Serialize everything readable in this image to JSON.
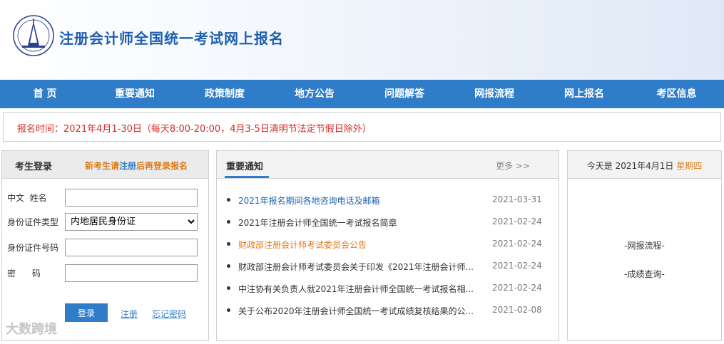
{
  "header": {
    "title": "注册会计师全国统一考试网上报名",
    "logo_icon": "cicpa-emblem-icon"
  },
  "nav": [
    {
      "label": "首 页"
    },
    {
      "label": "重要通知"
    },
    {
      "label": "政策制度"
    },
    {
      "label": "地方公告"
    },
    {
      "label": "问题解答"
    },
    {
      "label": "网报流程"
    },
    {
      "label": "网上报名"
    },
    {
      "label": "考区信息"
    }
  ],
  "notice": {
    "text": "报名时间：2021年4月1-30日（每天8:00-20:00，4月3-5日清明节法定节假日除外）"
  },
  "login": {
    "title": "考生登录",
    "hint_prefix": "新考生请",
    "hint_link": "注册",
    "hint_suffix": "后再登录报名",
    "name_label": "中文  姓名",
    "id_type_label": "身份证件类型",
    "id_type_value": "内地居民身份证",
    "id_number_label": "身份证件号码",
    "password_label": "密      码",
    "login_button": "登录",
    "register_link": "注册",
    "forgot_link": "忘记密码"
  },
  "news": {
    "title": "重要通知",
    "more": "更多 >>",
    "items": [
      {
        "title": "2021年报名期间各地咨询电话及邮箱",
        "date": "2021-03-31",
        "color": "#1d5fae"
      },
      {
        "title": "2021年注册会计师全国统一考试报名简章",
        "date": "2021-02-24",
        "color": "#333333"
      },
      {
        "title": "财政部注册会计师考试委员会公告",
        "date": "2021-02-24",
        "color": "#e07b1a"
      },
      {
        "title": "财政部注册会计师考试委员会关于印发《2021年注册会计师...",
        "date": "2021-02-24",
        "color": "#333333"
      },
      {
        "title": "中注协有关负责人就2021年注册会计师全国统一考试报名相...",
        "date": "2021-02-24",
        "color": "#333333"
      },
      {
        "title": "关于公布2020年注册会计师全国统一考试成绩复核结果的公...",
        "date": "2021-02-08",
        "color": "#333333"
      }
    ]
  },
  "date_panel": {
    "prefix": "今天是 2021年4月1日",
    "weekday": "星期四",
    "link1": "-网报流程-",
    "link2": "-成绩查询-"
  },
  "watermark": "大数跨境",
  "colors": {
    "nav_bg": "#2f7cc9",
    "title": "#1d5fae",
    "notice_text": "#d22b2b",
    "accent_orange": "#e07b1a"
  }
}
